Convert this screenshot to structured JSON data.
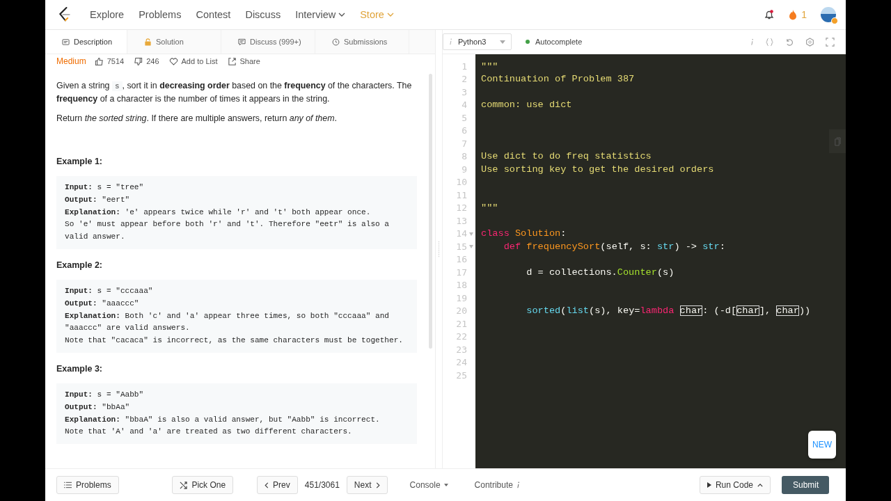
{
  "nav": {
    "items": [
      {
        "label": "Explore",
        "kind": "link"
      },
      {
        "label": "Problems",
        "kind": "link"
      },
      {
        "label": "Contest",
        "kind": "link"
      },
      {
        "label": "Discuss",
        "kind": "link"
      },
      {
        "label": "Interview",
        "kind": "dropdown"
      },
      {
        "label": "Store",
        "kind": "store"
      }
    ],
    "streak": "1",
    "notification": true
  },
  "tabs": [
    {
      "label": "Description",
      "selected": true
    },
    {
      "label": "Solution",
      "selected": false
    },
    {
      "label": "Discuss (999+)",
      "selected": false
    },
    {
      "label": "Submissions",
      "selected": false
    }
  ],
  "meta": {
    "difficulty": "Medium",
    "likes": "7514",
    "dislikes": "246",
    "add_to_list": "Add to List",
    "share": "Share"
  },
  "description": [
    [
      {
        "t": "Given a string ",
        "kind": "plain"
      },
      {
        "t": "s",
        "kind": "code"
      },
      {
        "t": ", sort it in ",
        "kind": "plain"
      },
      {
        "t": "decreasing order",
        "kind": "bold"
      },
      {
        "t": " based on the ",
        "kind": "plain"
      },
      {
        "t": "frequency",
        "kind": "bold"
      },
      {
        "t": " of the characters. The ",
        "kind": "plain"
      },
      {
        "t": "frequency",
        "kind": "bold"
      },
      {
        "t": " of a character is the number of times it appears in the string.",
        "kind": "plain"
      }
    ],
    [
      {
        "t": "Return ",
        "kind": "plain"
      },
      {
        "t": "the sorted string",
        "kind": "italic"
      },
      {
        "t": ". If there are multiple answers, return ",
        "kind": "plain"
      },
      {
        "t": "any of them",
        "kind": "italic"
      },
      {
        "t": ".",
        "kind": "plain"
      }
    ]
  ],
  "examples": [
    {
      "title": "Example 1:",
      "lines": [
        "**Input:** s = \"tree\"",
        "**Output:** \"eert\"",
        "**Explanation:** 'e' appears twice while 'r' and 't' both appear once.",
        "So 'e' must appear before both 'r' and 't'. Therefore \"eetr\" is also a",
        "valid answer."
      ]
    },
    {
      "title": "Example 2:",
      "lines": [
        "**Input:** s = \"cccaaa\"",
        "**Output:** \"aaaccc\"",
        "**Explanation:** Both 'c' and 'a' appear three times, so both \"cccaaa\" and",
        "\"aaaccc\" are valid answers.",
        "Note that \"cacaca\" is incorrect, as the same characters must be together."
      ]
    },
    {
      "title": "Example 3:",
      "lines": [
        "**Input:** s = \"Aabb\"",
        "**Output:** \"bbAa\"",
        "**Explanation:** \"bbaA\" is also a valid answer, but \"Aabb\" is incorrect.",
        "Note that 'A' and 'a' are treated as two different characters."
      ]
    }
  ],
  "editor": {
    "language": "Python3",
    "autocomplete": "Autocomplete",
    "autocomplete_on": true,
    "lines": [
      {
        "n": "1",
        "fold": false,
        "tokens": [
          {
            "t": "\"\"\"",
            "kind": "str"
          }
        ]
      },
      {
        "n": "2",
        "fold": false,
        "tokens": [
          {
            "t": "Continuation of Problem 387",
            "kind": "str"
          }
        ]
      },
      {
        "n": "3",
        "fold": false
      },
      {
        "n": "4",
        "fold": false,
        "tokens": [
          {
            "t": "common: use dict",
            "kind": "str"
          }
        ]
      },
      {
        "n": "5",
        "fold": false
      },
      {
        "n": "6",
        "fold": false
      },
      {
        "n": "7",
        "fold": false
      },
      {
        "n": "8",
        "fold": false,
        "tokens": [
          {
            "t": "Use dict to do freq statistics",
            "kind": "str"
          }
        ]
      },
      {
        "n": "9",
        "fold": false,
        "tokens": [
          {
            "t": "Use sorting key to get the desired orders",
            "kind": "str"
          }
        ]
      },
      {
        "n": "10",
        "fold": false
      },
      {
        "n": "11",
        "fold": false
      },
      {
        "n": "12",
        "fold": false,
        "tokens": [
          {
            "t": "\"\"\"",
            "kind": "str"
          }
        ]
      },
      {
        "n": "13",
        "fold": false
      },
      {
        "n": "14",
        "fold": true,
        "tokens": [
          {
            "t": "class ",
            "kind": "kw"
          },
          {
            "t": "Solution",
            "kind": "name"
          },
          {
            "t": ":",
            "kind": "plain"
          }
        ]
      },
      {
        "n": "15",
        "fold": true,
        "tokens": [
          {
            "t": "    def ",
            "kind": "kw"
          },
          {
            "t": "frequencySort",
            "kind": "name"
          },
          {
            "t": "(self, s: ",
            "kind": "plain"
          },
          {
            "t": "str",
            "kind": "builtin"
          },
          {
            "t": ") -> ",
            "kind": "plain"
          },
          {
            "t": "str",
            "kind": "builtin"
          },
          {
            "t": ":",
            "kind": "plain"
          }
        ]
      },
      {
        "n": "16",
        "fold": false
      },
      {
        "n": "17",
        "fold": false,
        "tokens": [
          {
            "t": "        d = collections.",
            "kind": "plain"
          },
          {
            "t": "Counter",
            "kind": "call"
          },
          {
            "t": "(s)",
            "kind": "plain"
          }
        ]
      },
      {
        "n": "18",
        "fold": false
      },
      {
        "n": "19",
        "fold": false
      },
      {
        "n": "20",
        "fold": false,
        "tokens": [
          {
            "t": "        sorted",
            "kind": "builtin"
          },
          {
            "t": "(",
            "kind": "plain"
          },
          {
            "t": "list",
            "kind": "builtin"
          },
          {
            "t": "(s), key=",
            "kind": "plain"
          },
          {
            "t": "lambda ",
            "kind": "kw"
          },
          {
            "t": "char",
            "kind": "match"
          },
          {
            "t": ": (-d[",
            "kind": "plain"
          },
          {
            "t": "char",
            "kind": "match"
          },
          {
            "t": "], ",
            "kind": "plain"
          },
          {
            "t": "char",
            "kind": "match"
          },
          {
            "t": "))",
            "kind": "plain"
          }
        ]
      },
      {
        "n": "21",
        "fold": false
      },
      {
        "n": "22",
        "fold": false
      },
      {
        "n": "23",
        "fold": false
      },
      {
        "n": "24",
        "fold": false
      },
      {
        "n": "25",
        "fold": false
      }
    ],
    "new_badge": "NEW"
  },
  "footer": {
    "problems": "Problems",
    "pick_one": "Pick One",
    "prev": "Prev",
    "position": "451/3061",
    "next": "Next",
    "console": "Console",
    "contribute": "Contribute",
    "run_code": "Run Code",
    "submit": "Submit"
  }
}
